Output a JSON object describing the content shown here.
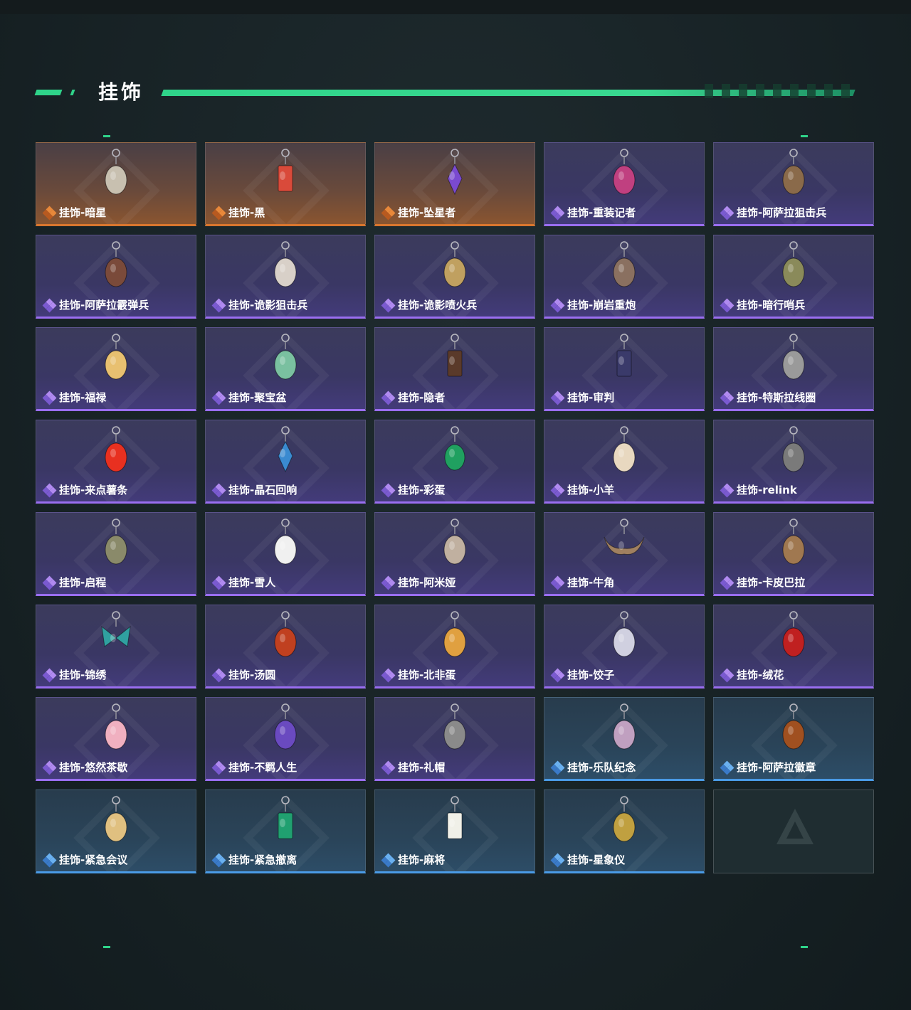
{
  "header": {
    "title": "挂饰"
  },
  "colors": {
    "accent": "#2fd48a",
    "legendary": "#d9762e",
    "epic": "#9a6ef0",
    "rare": "#4a9be6"
  },
  "items": [
    {
      "label": "挂饰-暗星",
      "rarity": "orange",
      "icon": "crane-charm-icon",
      "color": "#c8c0b0"
    },
    {
      "label": "挂饰-黑",
      "rarity": "orange",
      "icon": "tag-charm-icon",
      "color": "#d94a3a"
    },
    {
      "label": "挂饰-坠星者",
      "rarity": "orange",
      "icon": "crystal-charm-icon",
      "color": "#7a4ad0"
    },
    {
      "label": "挂饰-重装记者",
      "rarity": "purple",
      "icon": "figure-charm-icon",
      "color": "#c04080"
    },
    {
      "label": "挂饰-阿萨拉狙击兵",
      "rarity": "purple",
      "icon": "figure-charm-icon",
      "color": "#8a6a4a"
    },
    {
      "label": "挂饰-阿萨拉霰弹兵",
      "rarity": "purple",
      "icon": "figure-charm-icon",
      "color": "#7a4a3a"
    },
    {
      "label": "挂饰-诡影狙击兵",
      "rarity": "purple",
      "icon": "figure-charm-icon",
      "color": "#d8d0c8"
    },
    {
      "label": "挂饰-诡影喷火兵",
      "rarity": "purple",
      "icon": "figure-charm-icon",
      "color": "#c0a060"
    },
    {
      "label": "挂饰-崩岩重炮",
      "rarity": "purple",
      "icon": "figure-charm-icon",
      "color": "#8a7060"
    },
    {
      "label": "挂饰-暗行哨兵",
      "rarity": "purple",
      "icon": "figure-charm-icon",
      "color": "#8a8a5a"
    },
    {
      "label": "挂饰-福禄",
      "rarity": "purple",
      "icon": "gourd-charm-icon",
      "color": "#e8c070"
    },
    {
      "label": "挂饰-聚宝盆",
      "rarity": "purple",
      "icon": "treasure-bowl-charm-icon",
      "color": "#7ac0a0"
    },
    {
      "label": "挂饰-隐者",
      "rarity": "purple",
      "icon": "card-charm-icon",
      "color": "#5a3a2a"
    },
    {
      "label": "挂饰-审判",
      "rarity": "purple",
      "icon": "card-charm-icon",
      "color": "#3a3a6a"
    },
    {
      "label": "挂饰-特斯拉线圈",
      "rarity": "purple",
      "icon": "coil-charm-icon",
      "color": "#9a9a9a"
    },
    {
      "label": "挂饰-来点薯条",
      "rarity": "purple",
      "icon": "fries-charm-icon",
      "color": "#e83020"
    },
    {
      "label": "挂饰-晶石回响",
      "rarity": "purple",
      "icon": "crystal-charm-icon",
      "color": "#3a8ad0"
    },
    {
      "label": "挂饰-彩蛋",
      "rarity": "purple",
      "icon": "egg-charm-icon",
      "color": "#20a060"
    },
    {
      "label": "挂饰-小羊",
      "rarity": "purple",
      "icon": "sheep-charm-icon",
      "color": "#e8d8c0"
    },
    {
      "label": "挂饰-relink",
      "rarity": "purple",
      "icon": "emblem-charm-icon",
      "color": "#7a7a7a"
    },
    {
      "label": "挂饰-启程",
      "rarity": "purple",
      "icon": "medal-charm-icon",
      "color": "#8a8a6a"
    },
    {
      "label": "挂饰-雪人",
      "rarity": "purple",
      "icon": "snowman-charm-icon",
      "color": "#f0f0f0"
    },
    {
      "label": "挂饰-阿米娅",
      "rarity": "purple",
      "icon": "figure-charm-icon",
      "color": "#c0b0a0"
    },
    {
      "label": "挂饰-牛角",
      "rarity": "purple",
      "icon": "horns-charm-icon",
      "color": "#a08060"
    },
    {
      "label": "挂饰-卡皮巴拉",
      "rarity": "purple",
      "icon": "capybara-charm-icon",
      "color": "#a07850"
    },
    {
      "label": "挂饰-锦绣",
      "rarity": "purple",
      "icon": "butterfly-charm-icon",
      "color": "#30a0a0"
    },
    {
      "label": "挂饰-汤圆",
      "rarity": "purple",
      "icon": "bowl-charm-icon",
      "color": "#c04020"
    },
    {
      "label": "挂饰-北非蛋",
      "rarity": "purple",
      "icon": "bowl-charm-icon",
      "color": "#e0a040"
    },
    {
      "label": "挂饰-饺子",
      "rarity": "purple",
      "icon": "plate-charm-icon",
      "color": "#d0d0e0"
    },
    {
      "label": "挂饰-绒花",
      "rarity": "purple",
      "icon": "flower-charm-icon",
      "color": "#c02020"
    },
    {
      "label": "挂饰-悠然茶歇",
      "rarity": "purple",
      "icon": "cupcake-charm-icon",
      "color": "#f0b0c0"
    },
    {
      "label": "挂饰-不羁人生",
      "rarity": "purple",
      "icon": "sneaker-charm-icon",
      "color": "#6a4ac0"
    },
    {
      "label": "挂饰-礼帽",
      "rarity": "purple",
      "icon": "hat-charm-icon",
      "color": "#8a8a8a"
    },
    {
      "label": "挂饰-乐队纪念",
      "rarity": "blue",
      "icon": "badge-charm-icon",
      "color": "#c0a0c0"
    },
    {
      "label": "挂饰-阿萨拉徽章",
      "rarity": "blue",
      "icon": "badge-charm-icon",
      "color": "#a05020"
    },
    {
      "label": "挂饰-紧急会议",
      "rarity": "blue",
      "icon": "figure-charm-icon",
      "color": "#e0c080"
    },
    {
      "label": "挂饰-紧急撤离",
      "rarity": "blue",
      "icon": "card-charm-icon",
      "color": "#20a070"
    },
    {
      "label": "挂饰-麻将",
      "rarity": "blue",
      "icon": "mahjong-charm-icon",
      "color": "#f0f0e8"
    },
    {
      "label": "挂饰-星象仪",
      "rarity": "blue",
      "icon": "astrolabe-charm-icon",
      "color": "#c0a040"
    }
  ]
}
